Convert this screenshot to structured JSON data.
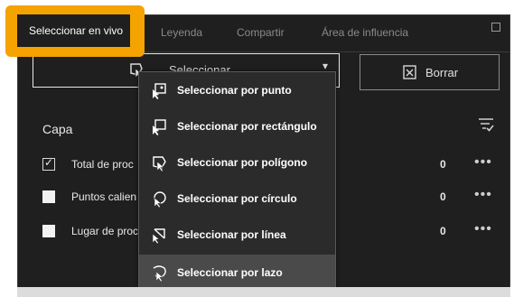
{
  "tabs": [
    {
      "label": "Seleccionar en vivo",
      "active": true
    },
    {
      "label": "Leyenda",
      "active": false
    },
    {
      "label": "Compartir",
      "active": false
    },
    {
      "label": "Área de influencia",
      "active": false
    }
  ],
  "toolbar": {
    "select_label": "Seleccionar",
    "clear_label": "Borrar"
  },
  "layers": {
    "header": "Capa",
    "items": [
      {
        "label": "Total de proc",
        "count": "0",
        "checked": true
      },
      {
        "label": "Puntos calien",
        "count": "0",
        "checked": false
      },
      {
        "label": "Lugar de proc",
        "count": "0",
        "checked": false
      }
    ],
    "more": "•••"
  },
  "dropdown": {
    "items": [
      {
        "label": "Seleccionar por punto"
      },
      {
        "label": "Seleccionar por rectángulo"
      },
      {
        "label": "Seleccionar por polígono"
      },
      {
        "label": "Seleccionar por círculo"
      },
      {
        "label": "Seleccionar por línea"
      },
      {
        "label": "Seleccionar por lazo",
        "hover": true
      }
    ]
  },
  "colors": {
    "highlight": "#f4a300",
    "panel_bg": "#1f1f1f",
    "dropdown_bg": "#2b2b2b",
    "hover_bg": "#4a4a4a"
  }
}
